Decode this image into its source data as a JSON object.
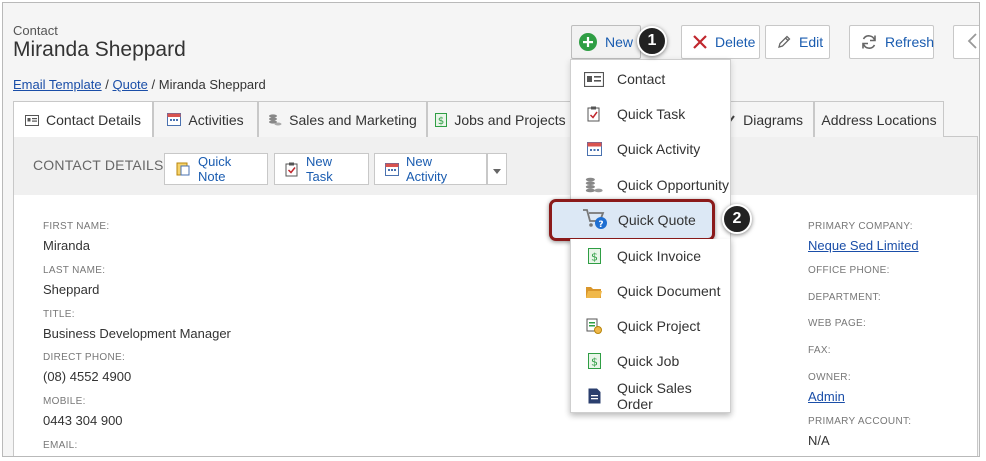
{
  "header": {
    "entity_label": "Contact",
    "title": "Miranda Sheppard",
    "breadcrumb": {
      "link1": "Email Template",
      "sep1": " / ",
      "link2": "Quote",
      "sep2": " / ",
      "current": "Miranda Sheppard"
    }
  },
  "toolbar": {
    "new_label": "New",
    "delete_label": "Delete",
    "edit_label": "Edit",
    "refresh_label": "Refresh"
  },
  "callouts": {
    "one": "1",
    "two": "2"
  },
  "tabs": [
    {
      "label": "Contact Details",
      "icon": "id-card-icon"
    },
    {
      "label": "Activities",
      "icon": "calendar-icon"
    },
    {
      "label": "Sales and Marketing",
      "icon": "coins-icon"
    },
    {
      "label": "Jobs and Projects",
      "icon": "dollar-doc-icon"
    },
    {
      "label": "Diagrams",
      "icon": "diagram-icon"
    },
    {
      "label": "Address Locations",
      "icon": ""
    }
  ],
  "section": {
    "title": "CONTACT DETAILS",
    "quick_note": "Quick Note",
    "new_task": "New Task",
    "new_activity": "New Activity"
  },
  "fields_left": [
    {
      "label": "FIRST NAME:",
      "value": "Miranda"
    },
    {
      "label": "LAST NAME:",
      "value": "Sheppard"
    },
    {
      "label": "TITLE:",
      "value": "Business Development Manager"
    },
    {
      "label": "DIRECT PHONE:",
      "value": "(08) 4552 4900"
    },
    {
      "label": "MOBILE:",
      "value": "0443 304 900"
    },
    {
      "label": "EMAIL:",
      "value": ""
    }
  ],
  "fields_right": [
    {
      "label": "PRIMARY COMPANY:",
      "value": "Neque Sed Limited"
    },
    {
      "label": "OFFICE PHONE:",
      "value": ""
    },
    {
      "label": "DEPARTMENT:",
      "value": ""
    },
    {
      "label": "WEB PAGE:",
      "value": ""
    },
    {
      "label": "FAX:",
      "value": ""
    },
    {
      "label": "OWNER:",
      "value": "Admin"
    },
    {
      "label": "PRIMARY ACCOUNT:",
      "value": "N/A"
    }
  ],
  "new_menu": [
    {
      "label": "Contact",
      "icon": "contact-card-icon"
    },
    {
      "label": "Quick Task",
      "icon": "task-icon"
    },
    {
      "label": "Quick Activity",
      "icon": "calendar-icon"
    },
    {
      "label": "Quick Opportunity",
      "icon": "coins-icon"
    },
    {
      "label": "Quick Quote",
      "icon": "cart-question-icon"
    },
    {
      "label": "Quick Invoice",
      "icon": "dollar-doc-icon"
    },
    {
      "label": "Quick Document",
      "icon": "folder-icon"
    },
    {
      "label": "Quick Project",
      "icon": "project-icon"
    },
    {
      "label": "Quick Job",
      "icon": "dollar-doc-icon"
    },
    {
      "label": "Quick Sales Order",
      "icon": "document-icon"
    }
  ],
  "colors": {
    "link": "#1a4ea8",
    "accent_green": "#2f9e44",
    "delete_red": "#c0272d",
    "highlight_border": "#8b1a1a"
  }
}
